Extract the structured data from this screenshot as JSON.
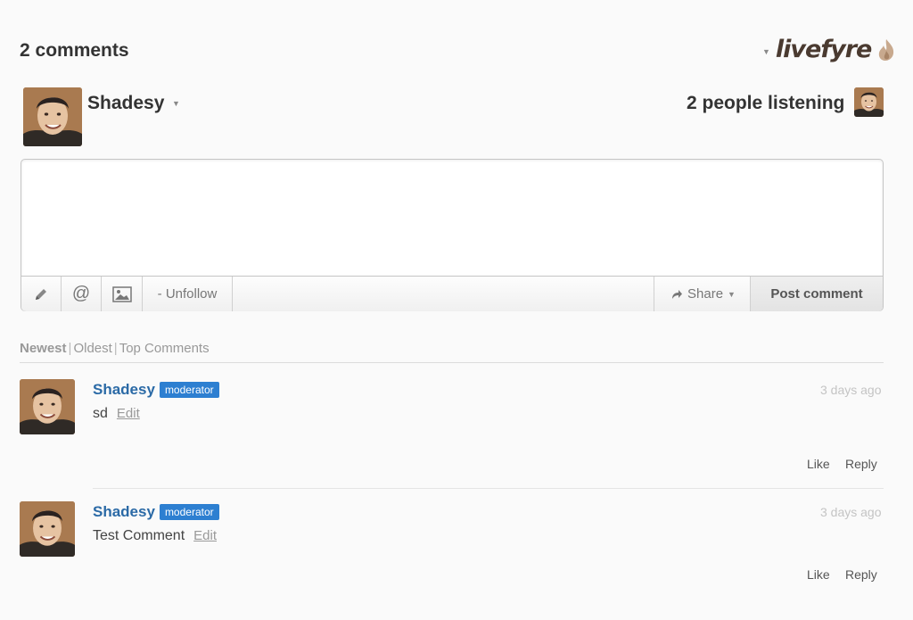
{
  "header": {
    "comment_count": "2 comments",
    "brand": "livefyre"
  },
  "user": {
    "name": "Shadesy",
    "listening": "2 people listening"
  },
  "editor": {
    "value": "",
    "unfollow_label": "- Unfollow",
    "share_label": "Share",
    "post_label": "Post comment"
  },
  "sort": {
    "options": [
      "Newest",
      "Oldest",
      "Top Comments"
    ],
    "active": "Newest"
  },
  "comments": [
    {
      "author": "Shadesy",
      "badge": "moderator",
      "time": "3 days ago",
      "body": "sd",
      "edit": "Edit",
      "like": "Like",
      "reply": "Reply"
    },
    {
      "author": "Shadesy",
      "badge": "moderator",
      "time": "3 days ago",
      "body": "Test Comment",
      "edit": "Edit",
      "like": "Like",
      "reply": "Reply"
    }
  ],
  "colors": {
    "author_link": "#2b6aa6",
    "moderator_badge": "#2d7fd1",
    "background": "#fafafa"
  }
}
